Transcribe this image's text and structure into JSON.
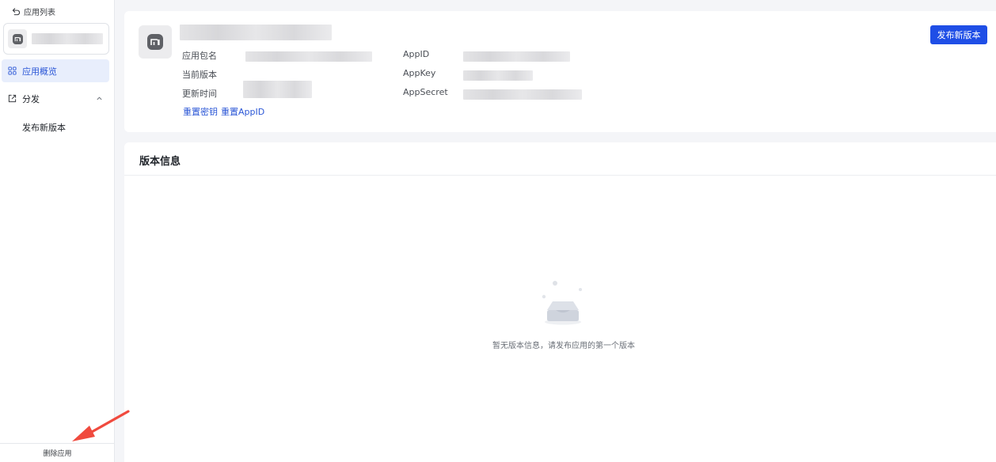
{
  "sidebar": {
    "back_label": "应用列表",
    "nav": {
      "overview": "应用概览",
      "distribution": "分发",
      "publish_new": "发布新版本"
    },
    "delete_label": "删除应用"
  },
  "app_info": {
    "logo_text": "MI",
    "labels": {
      "package": "应用包名",
      "current_version": "当前版本",
      "update_time": "更新时间",
      "app_id": "AppID",
      "app_key": "AppKey",
      "app_secret": "AppSecret"
    },
    "actions": {
      "reset_secret": "重置密钥",
      "reset_appid": "重置AppID"
    },
    "publish_button": "发布新版本"
  },
  "versions": {
    "title": "版本信息",
    "empty_text": "暂无版本信息，请发布应用的第一个版本"
  },
  "colors": {
    "accent": "#1f4ee6",
    "link": "#2a56d6",
    "active_bg": "#e8eefc",
    "annotation": "#f04a3e"
  }
}
